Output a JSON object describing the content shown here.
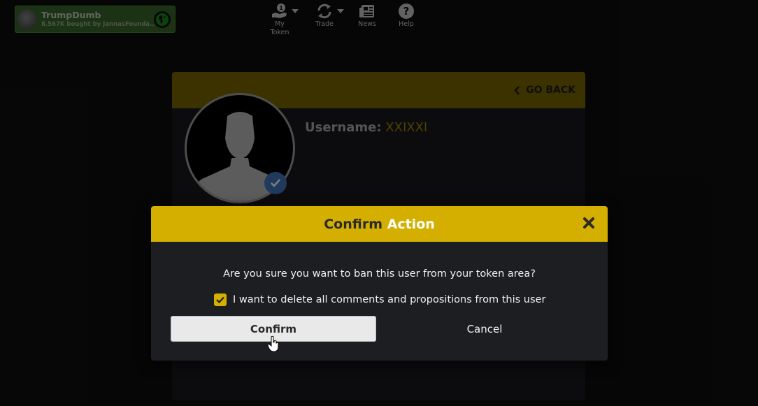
{
  "toast": {
    "title": "TrumpDumb",
    "subtitle": "8.567K bought by JannasFounda...",
    "globe_icon": "globe-icon"
  },
  "nav": {
    "items": [
      {
        "label": "My\nToken",
        "icon": "hand-coin-icon",
        "has_caret": true
      },
      {
        "label": "Trade",
        "icon": "refresh-icon",
        "has_caret": true
      },
      {
        "label": "News",
        "icon": "newspaper-icon",
        "has_caret": false
      },
      {
        "label": "Help",
        "icon": "question-circle-icon",
        "has_caret": false
      }
    ]
  },
  "profile": {
    "go_back_label": "GO BACK",
    "username_label": "Username:",
    "username_value": "XXIXXI"
  },
  "modal": {
    "title_part1": "Confirm",
    "title_part2": "Action",
    "question": "Are you sure you want to ban this user from your token area?",
    "checkbox_label": "I want to delete all comments and propositions from this user",
    "checkbox_checked": true,
    "confirm_label": "Confirm",
    "cancel_label": "Cancel"
  },
  "colors": {
    "accent": "#d4af00",
    "header_dim": "#6e5c00",
    "background": "#0c0c0d",
    "verified": "#3c6aa8",
    "toast": "#3b6b2a"
  }
}
